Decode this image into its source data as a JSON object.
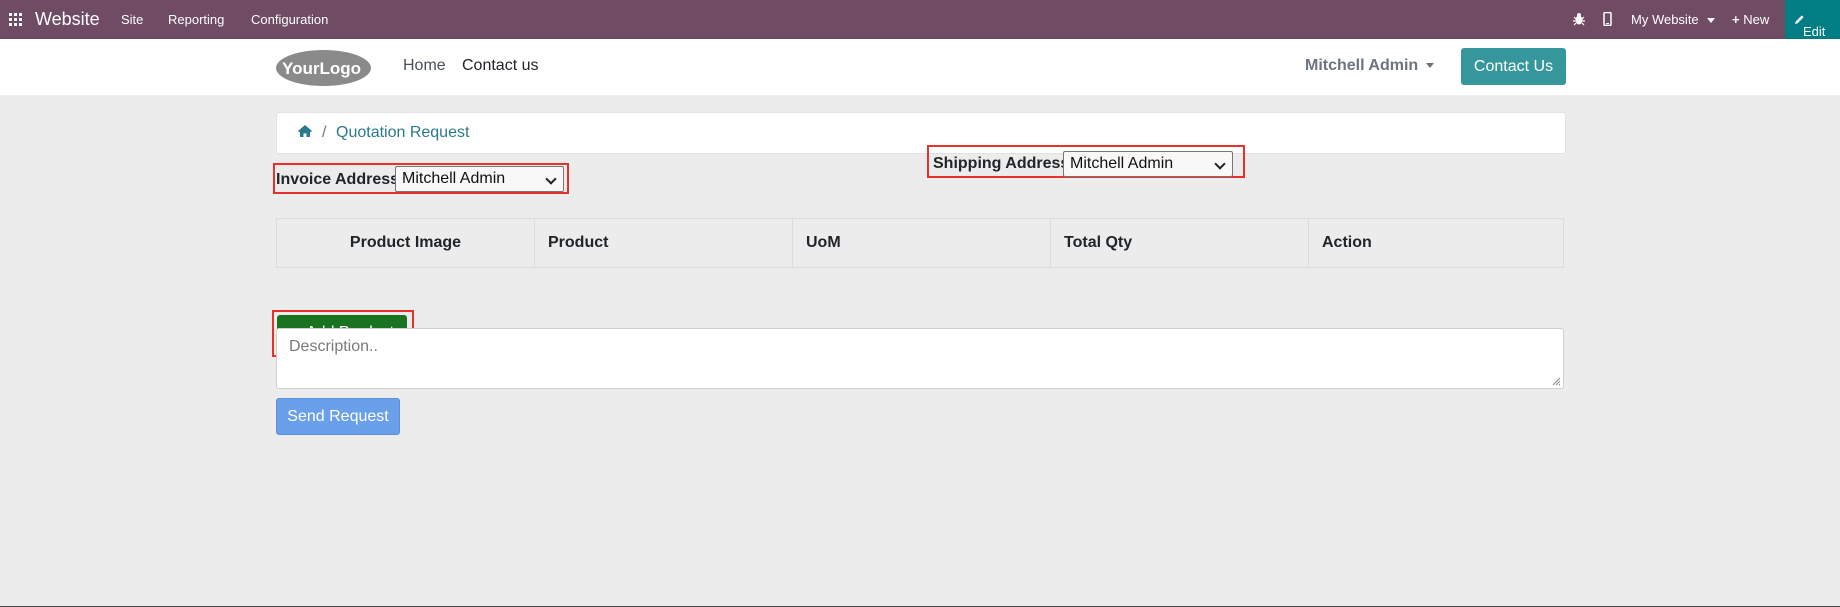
{
  "topbar": {
    "app_name": "Website",
    "menu": [
      "Site",
      "Reporting",
      "Configuration"
    ],
    "website_switcher": "My Website",
    "new_label": "New",
    "edit_label": "Edit",
    "icons": [
      "apps-grid-icon",
      "bug-icon",
      "mobile-icon",
      "plus-icon",
      "pencil-icon"
    ],
    "colors": {
      "bar": "#6f4b64",
      "edit": "#017e84"
    }
  },
  "header": {
    "logo_text": "YourLogo",
    "nav": [
      "Home",
      "Contact us"
    ],
    "user": "Mitchell Admin",
    "contact_button": "Contact Us",
    "colors": {
      "contact_button": "#35979c"
    }
  },
  "breadcrumb": {
    "home_icon": "home-icon",
    "separator": "/",
    "current": "Quotation Request"
  },
  "form": {
    "invoice_label": "Invoice Address",
    "invoice_value": "Mitchell Admin",
    "shipping_label": "Shipping Address",
    "shipping_value": "Mitchell Admin",
    "columns": [
      "Product Image",
      "Product",
      "UoM",
      "Total Qty",
      "Action"
    ],
    "add_product_label": "Add Product",
    "description_placeholder": "Description..",
    "send_label": "Send Request",
    "colors": {
      "add_button": "#1a7321",
      "send_button": "#6aa0ea",
      "highlight": "#e5322d"
    }
  }
}
